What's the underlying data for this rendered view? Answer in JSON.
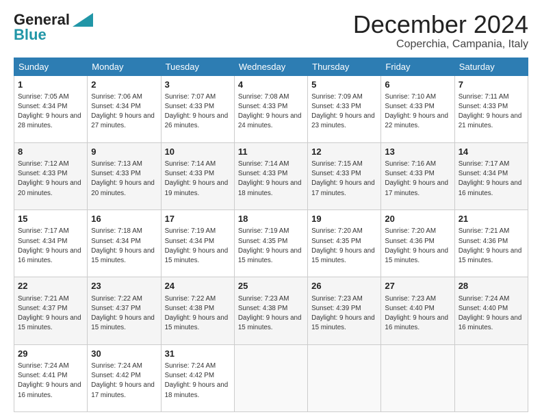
{
  "header": {
    "logo_general": "General",
    "logo_blue": "Blue",
    "title": "December 2024",
    "subtitle": "Coperchia, Campania, Italy"
  },
  "weekdays": [
    "Sunday",
    "Monday",
    "Tuesday",
    "Wednesday",
    "Thursday",
    "Friday",
    "Saturday"
  ],
  "weeks": [
    [
      {
        "day": "1",
        "sunrise": "7:05 AM",
        "sunset": "4:34 PM",
        "daylight": "9 hours and 28 minutes."
      },
      {
        "day": "2",
        "sunrise": "7:06 AM",
        "sunset": "4:34 PM",
        "daylight": "9 hours and 27 minutes."
      },
      {
        "day": "3",
        "sunrise": "7:07 AM",
        "sunset": "4:33 PM",
        "daylight": "9 hours and 26 minutes."
      },
      {
        "day": "4",
        "sunrise": "7:08 AM",
        "sunset": "4:33 PM",
        "daylight": "9 hours and 24 minutes."
      },
      {
        "day": "5",
        "sunrise": "7:09 AM",
        "sunset": "4:33 PM",
        "daylight": "9 hours and 23 minutes."
      },
      {
        "day": "6",
        "sunrise": "7:10 AM",
        "sunset": "4:33 PM",
        "daylight": "9 hours and 22 minutes."
      },
      {
        "day": "7",
        "sunrise": "7:11 AM",
        "sunset": "4:33 PM",
        "daylight": "9 hours and 21 minutes."
      }
    ],
    [
      {
        "day": "8",
        "sunrise": "7:12 AM",
        "sunset": "4:33 PM",
        "daylight": "9 hours and 20 minutes."
      },
      {
        "day": "9",
        "sunrise": "7:13 AM",
        "sunset": "4:33 PM",
        "daylight": "9 hours and 20 minutes."
      },
      {
        "day": "10",
        "sunrise": "7:14 AM",
        "sunset": "4:33 PM",
        "daylight": "9 hours and 19 minutes."
      },
      {
        "day": "11",
        "sunrise": "7:14 AM",
        "sunset": "4:33 PM",
        "daylight": "9 hours and 18 minutes."
      },
      {
        "day": "12",
        "sunrise": "7:15 AM",
        "sunset": "4:33 PM",
        "daylight": "9 hours and 17 minutes."
      },
      {
        "day": "13",
        "sunrise": "7:16 AM",
        "sunset": "4:33 PM",
        "daylight": "9 hours and 17 minutes."
      },
      {
        "day": "14",
        "sunrise": "7:17 AM",
        "sunset": "4:34 PM",
        "daylight": "9 hours and 16 minutes."
      }
    ],
    [
      {
        "day": "15",
        "sunrise": "7:17 AM",
        "sunset": "4:34 PM",
        "daylight": "9 hours and 16 minutes."
      },
      {
        "day": "16",
        "sunrise": "7:18 AM",
        "sunset": "4:34 PM",
        "daylight": "9 hours and 15 minutes."
      },
      {
        "day": "17",
        "sunrise": "7:19 AM",
        "sunset": "4:34 PM",
        "daylight": "9 hours and 15 minutes."
      },
      {
        "day": "18",
        "sunrise": "7:19 AM",
        "sunset": "4:35 PM",
        "daylight": "9 hours and 15 minutes."
      },
      {
        "day": "19",
        "sunrise": "7:20 AM",
        "sunset": "4:35 PM",
        "daylight": "9 hours and 15 minutes."
      },
      {
        "day": "20",
        "sunrise": "7:20 AM",
        "sunset": "4:36 PM",
        "daylight": "9 hours and 15 minutes."
      },
      {
        "day": "21",
        "sunrise": "7:21 AM",
        "sunset": "4:36 PM",
        "daylight": "9 hours and 15 minutes."
      }
    ],
    [
      {
        "day": "22",
        "sunrise": "7:21 AM",
        "sunset": "4:37 PM",
        "daylight": "9 hours and 15 minutes."
      },
      {
        "day": "23",
        "sunrise": "7:22 AM",
        "sunset": "4:37 PM",
        "daylight": "9 hours and 15 minutes."
      },
      {
        "day": "24",
        "sunrise": "7:22 AM",
        "sunset": "4:38 PM",
        "daylight": "9 hours and 15 minutes."
      },
      {
        "day": "25",
        "sunrise": "7:23 AM",
        "sunset": "4:38 PM",
        "daylight": "9 hours and 15 minutes."
      },
      {
        "day": "26",
        "sunrise": "7:23 AM",
        "sunset": "4:39 PM",
        "daylight": "9 hours and 15 minutes."
      },
      {
        "day": "27",
        "sunrise": "7:23 AM",
        "sunset": "4:40 PM",
        "daylight": "9 hours and 16 minutes."
      },
      {
        "day": "28",
        "sunrise": "7:24 AM",
        "sunset": "4:40 PM",
        "daylight": "9 hours and 16 minutes."
      }
    ],
    [
      {
        "day": "29",
        "sunrise": "7:24 AM",
        "sunset": "4:41 PM",
        "daylight": "9 hours and 16 minutes."
      },
      {
        "day": "30",
        "sunrise": "7:24 AM",
        "sunset": "4:42 PM",
        "daylight": "9 hours and 17 minutes."
      },
      {
        "day": "31",
        "sunrise": "7:24 AM",
        "sunset": "4:42 PM",
        "daylight": "9 hours and 18 minutes."
      },
      null,
      null,
      null,
      null
    ]
  ],
  "labels": {
    "sunrise": "Sunrise:",
    "sunset": "Sunset:",
    "daylight": "Daylight:"
  }
}
